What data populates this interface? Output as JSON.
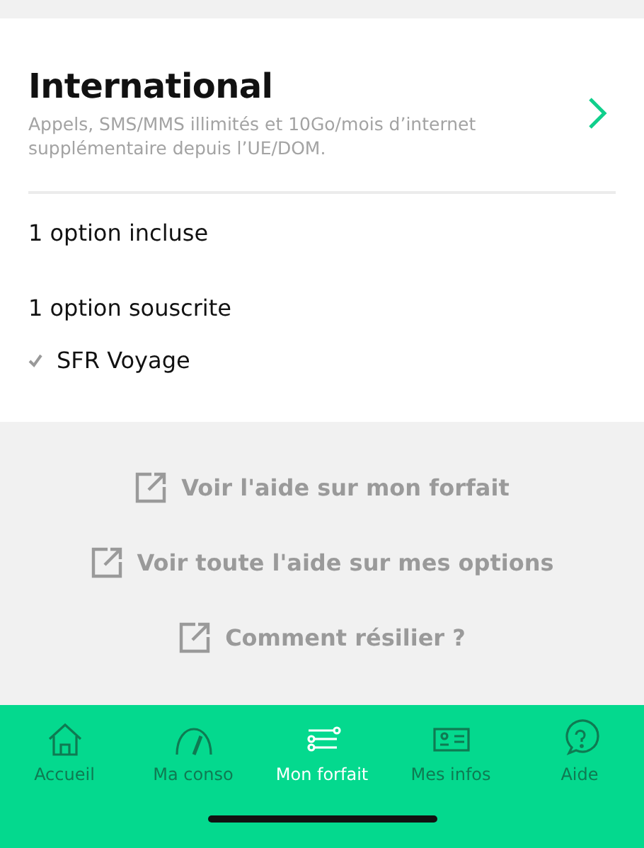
{
  "plan": {
    "title": "International",
    "description": "Appels, SMS/MMS illimités et 10Go/mois d’internet supplémentaire depuis l’UE/DOM."
  },
  "included": {
    "heading": "1 option incluse"
  },
  "subscribed": {
    "heading": "1 option souscrite",
    "options": [
      {
        "name": "SFR Voyage",
        "checked": true
      }
    ]
  },
  "help_links": [
    "Voir l'aide sur mon forfait",
    "Voir toute l'aide sur mes options",
    "Comment résilier ?"
  ],
  "tabs": [
    {
      "label": "Accueil",
      "selected": false
    },
    {
      "label": "Ma conso",
      "selected": false
    },
    {
      "label": "Mon forfait",
      "selected": true
    },
    {
      "label": "Mes infos",
      "selected": false
    },
    {
      "label": "Aide",
      "selected": false
    }
  ]
}
